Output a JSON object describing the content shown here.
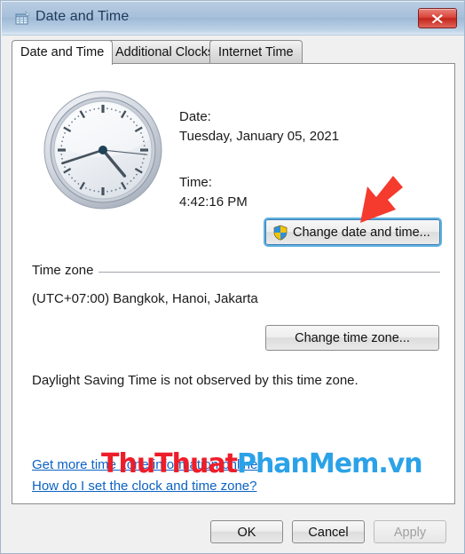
{
  "window": {
    "title": "Date and Time",
    "icon": "date-time-icon",
    "close_label": "Close"
  },
  "tabs": [
    {
      "label": "Date and Time",
      "active": true
    },
    {
      "label": "Additional Clocks",
      "active": false
    },
    {
      "label": "Internet Time",
      "active": false
    }
  ],
  "main": {
    "clock": {
      "icon": "analog-clock",
      "hour_angle": 140,
      "minute_angle": 252,
      "second_angle": 96
    },
    "date_label": "Date:",
    "date_value": "Tuesday, January 05, 2021",
    "time_label": "Time:",
    "time_value": "4:42:16 PM",
    "change_datetime_button": "Change date and time...",
    "change_datetime_shield": "uac-shield-icon",
    "timezone_group_title": "Time zone",
    "timezone_value": "(UTC+07:00) Bangkok, Hanoi, Jakarta",
    "change_timezone_button": "Change time zone...",
    "dst_text": "Daylight Saving Time is not observed by this time zone.",
    "link_more": "Get more time zone information online",
    "link_how": "How do I set the clock and time zone?"
  },
  "annotation": {
    "arrow": "red-arrow-down-left",
    "arrow_color": "#f53a2e"
  },
  "watermark": {
    "part1": "ThuThuat",
    "part2": "PhanMem.vn",
    "color1": "#ee1d2a",
    "color2": "#2ba2e8"
  },
  "footer": {
    "ok": "OK",
    "cancel": "Cancel",
    "apply": "Apply"
  },
  "colors": {
    "titlebar": "#a8c0da",
    "close": "#c3251c",
    "link": "#0b62c4",
    "focus_outline": "#5fb0e0"
  }
}
